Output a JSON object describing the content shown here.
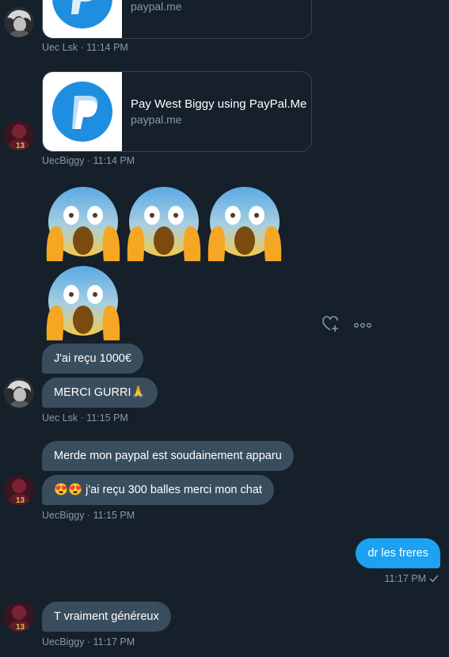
{
  "messages": {
    "m1": {
      "sender_meta": "Uec Lsk · 11:14 PM",
      "card_domain": "paypal.me"
    },
    "m2": {
      "card_title": "Pay West Biggy using PayPal.Me",
      "card_domain": "paypal.me",
      "sender_meta": "UecBiggy · 11:14 PM"
    },
    "m3": {
      "emojis": [
        "face-screaming-in-fear",
        "face-screaming-in-fear",
        "face-screaming-in-fear",
        "face-screaming-in-fear"
      ],
      "actions": [
        "heart-plus-icon",
        "more-icon"
      ]
    },
    "m4": {
      "bubble1": "J'ai reçu 1000€",
      "bubble2": "MERCI GURRI🙏",
      "sender_meta": "Uec Lsk · 11:15 PM"
    },
    "m5": {
      "bubble1": "Merde mon paypal est soudainement apparu",
      "bubble2_emoji": "😍😍",
      "bubble2_text": " j'ai reçu 300 balles merci mon chat",
      "sender_meta": "UecBiggy · 11:15 PM"
    },
    "m6": {
      "bubble": "dr les freres",
      "meta": "11:17 PM",
      "status_icon": "check-icon"
    },
    "m7": {
      "bubble": "T vraiment généreux",
      "sender_meta": "UecBiggy · 11:17 PM"
    }
  },
  "colors": {
    "background": "#15202b",
    "incoming_bubble": "#3a4d5c",
    "outgoing_bubble": "#1da1f2",
    "muted_text": "#8899a6",
    "paypal_blue": "#1f8ee0"
  }
}
